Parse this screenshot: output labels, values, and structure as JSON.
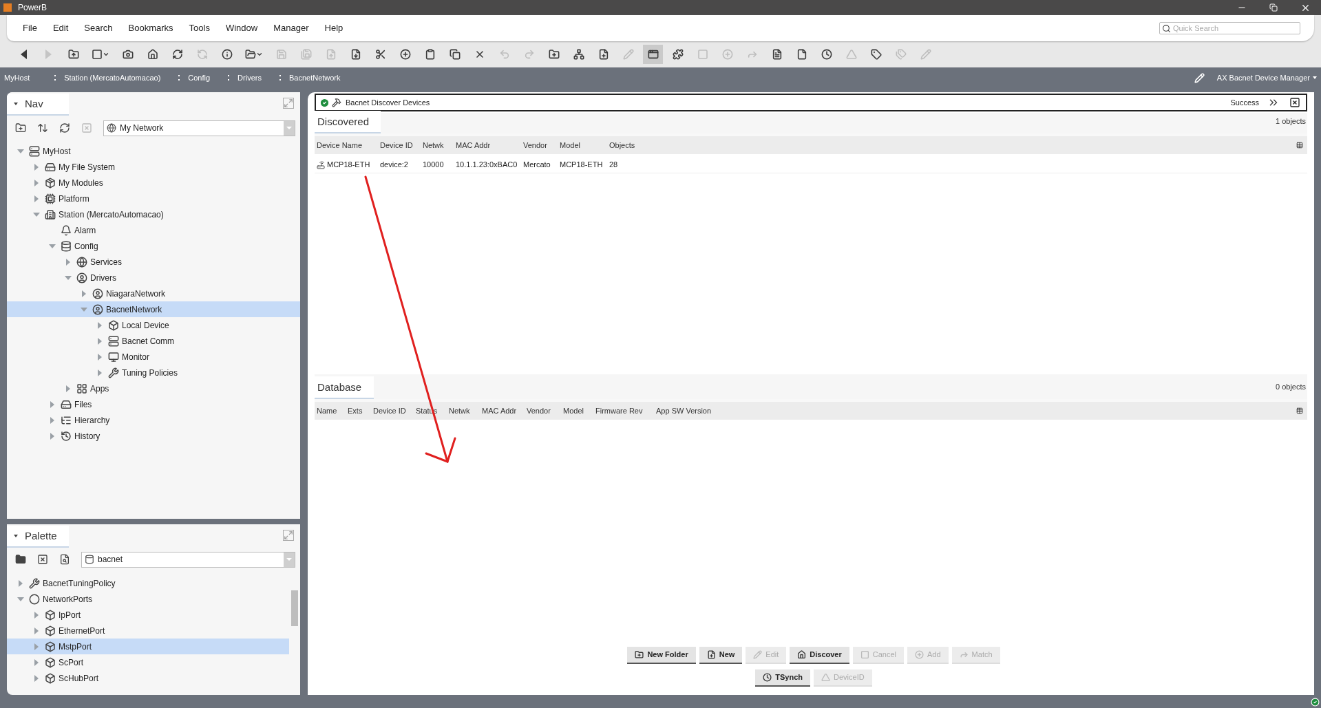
{
  "window": {
    "title": "PowerB"
  },
  "menu": [
    "File",
    "Edit",
    "Search",
    "Bookmarks",
    "Tools",
    "Window",
    "Manager",
    "Help"
  ],
  "quick_search": {
    "placeholder": "Quick Search"
  },
  "toolbar": [
    {
      "disabled": false,
      "pressed": false
    },
    {
      "disabled": true,
      "pressed": false
    },
    {
      "disabled": false,
      "pressed": false
    },
    {
      "disabled": false,
      "pressed": false
    },
    {
      "disabled": false,
      "pressed": false
    },
    {
      "disabled": false,
      "pressed": false
    },
    {
      "disabled": false,
      "pressed": false
    },
    {
      "disabled": true,
      "pressed": false
    },
    {
      "disabled": false,
      "pressed": false
    },
    {
      "disabled": false,
      "pressed": false
    },
    {
      "disabled": true,
      "pressed": false
    },
    {
      "disabled": true,
      "pressed": false
    },
    {
      "disabled": true,
      "pressed": false
    },
    {
      "disabled": false,
      "pressed": false
    },
    {
      "disabled": false,
      "pressed": false
    },
    {
      "disabled": false,
      "pressed": false
    },
    {
      "disabled": false,
      "pressed": false
    },
    {
      "disabled": false,
      "pressed": false
    },
    {
      "disabled": false,
      "pressed": false
    },
    {
      "disabled": true,
      "pressed": false
    },
    {
      "disabled": true,
      "pressed": false
    },
    {
      "disabled": false,
      "pressed": false
    },
    {
      "disabled": false,
      "pressed": false
    },
    {
      "disabled": false,
      "pressed": false
    },
    {
      "disabled": true,
      "pressed": false
    },
    {
      "disabled": false,
      "pressed": true
    },
    {
      "disabled": false,
      "pressed": false
    },
    {
      "disabled": true,
      "pressed": false
    },
    {
      "disabled": true,
      "pressed": false
    },
    {
      "disabled": true,
      "pressed": false
    },
    {
      "disabled": false,
      "pressed": false
    },
    {
      "disabled": false,
      "pressed": false
    },
    {
      "disabled": false,
      "pressed": false
    },
    {
      "disabled": true,
      "pressed": false
    },
    {
      "disabled": false,
      "pressed": false
    },
    {
      "disabled": true,
      "pressed": false
    },
    {
      "disabled": true,
      "pressed": false
    }
  ],
  "breadcrumb": [
    "MyHost",
    "Station (MercatoAutomacao)",
    "Config",
    "Drivers",
    "BacnetNetwork"
  ],
  "view_selector": "AX Bacnet Device Manager",
  "nav": {
    "title": "Nav",
    "dropdown": "My Network",
    "tree": [
      {
        "label": "MyHost",
        "expanded": true,
        "selected": false,
        "children": [
          {
            "label": "My File System",
            "expanded": false,
            "selected": false
          },
          {
            "label": "My Modules",
            "expanded": false,
            "selected": false
          },
          {
            "label": "Platform",
            "expanded": false,
            "selected": false
          },
          {
            "label": "Station (MercatoAutomacao)",
            "expanded": true,
            "selected": false,
            "children": [
              {
                "label": "Alarm",
                "selected": false
              },
              {
                "label": "Config",
                "expanded": true,
                "selected": false,
                "children": [
                  {
                    "label": "Services",
                    "expanded": false,
                    "selected": false
                  },
                  {
                    "label": "Drivers",
                    "expanded": true,
                    "selected": false,
                    "children": [
                      {
                        "label": "NiagaraNetwork",
                        "expanded": false,
                        "selected": false
                      },
                      {
                        "label": "BacnetNetwork",
                        "expanded": true,
                        "selected": true,
                        "children": [
                          {
                            "label": "Local Device",
                            "expanded": false,
                            "selected": false
                          },
                          {
                            "label": "Bacnet Comm",
                            "expanded": false,
                            "selected": false
                          },
                          {
                            "label": "Monitor",
                            "expanded": false,
                            "selected": false
                          },
                          {
                            "label": "Tuning Policies",
                            "expanded": false,
                            "selected": false
                          }
                        ]
                      }
                    ]
                  },
                  {
                    "label": "Apps",
                    "expanded": false,
                    "selected": false
                  }
                ]
              },
              {
                "label": "Files",
                "expanded": false,
                "selected": false
              },
              {
                "label": "Hierarchy",
                "expanded": false,
                "selected": false
              },
              {
                "label": "History",
                "expanded": false,
                "selected": false
              }
            ]
          }
        ]
      }
    ]
  },
  "palette": {
    "title": "Palette",
    "dropdown": "bacnet",
    "tree": [
      {
        "label": "BacnetTuningPolicy",
        "expanded": false,
        "selected": false
      },
      {
        "label": "NetworkPorts",
        "expanded": true,
        "selected": false,
        "children": [
          {
            "label": "IpPort",
            "expanded": false,
            "selected": false
          },
          {
            "label": "EthernetPort",
            "expanded": false,
            "selected": false
          },
          {
            "label": "MstpPort",
            "expanded": false,
            "selected": true
          },
          {
            "label": "ScPort",
            "expanded": false,
            "selected": false
          },
          {
            "label": "ScHubPort",
            "expanded": false,
            "selected": false
          }
        ]
      }
    ]
  },
  "job": {
    "title": "Bacnet Discover Devices",
    "status": "Success"
  },
  "discovered": {
    "title": "Discovered",
    "count": "1 objects",
    "columns": [
      "Device Name",
      "Device ID",
      "Netwk",
      "MAC Addr",
      "Vendor",
      "Model",
      "Objects"
    ],
    "rows": [
      [
        "MCP18-ETH",
        "device:2",
        "10000",
        "10.1.1.23:0xBAC0",
        "Mercato",
        "MCP18-ETH",
        "28"
      ]
    ]
  },
  "database": {
    "title": "Database",
    "count": "0 objects",
    "columns": [
      "Name",
      "Exts",
      "Device ID",
      "Status",
      "Netwk",
      "MAC Addr",
      "Vendor",
      "Model",
      "Firmware Rev",
      "App SW Version"
    ]
  },
  "buttons": [
    [
      {
        "label": "New Folder",
        "disabled": false
      },
      {
        "label": "New",
        "disabled": false
      },
      {
        "label": "Edit",
        "disabled": true
      },
      {
        "label": "Discover",
        "disabled": false
      },
      {
        "label": "Cancel",
        "disabled": true
      },
      {
        "label": "Add",
        "disabled": true
      },
      {
        "label": "Match",
        "disabled": true
      }
    ],
    [
      {
        "label": "TSynch",
        "disabled": false
      },
      {
        "label": "DeviceID",
        "disabled": true
      }
    ]
  ]
}
